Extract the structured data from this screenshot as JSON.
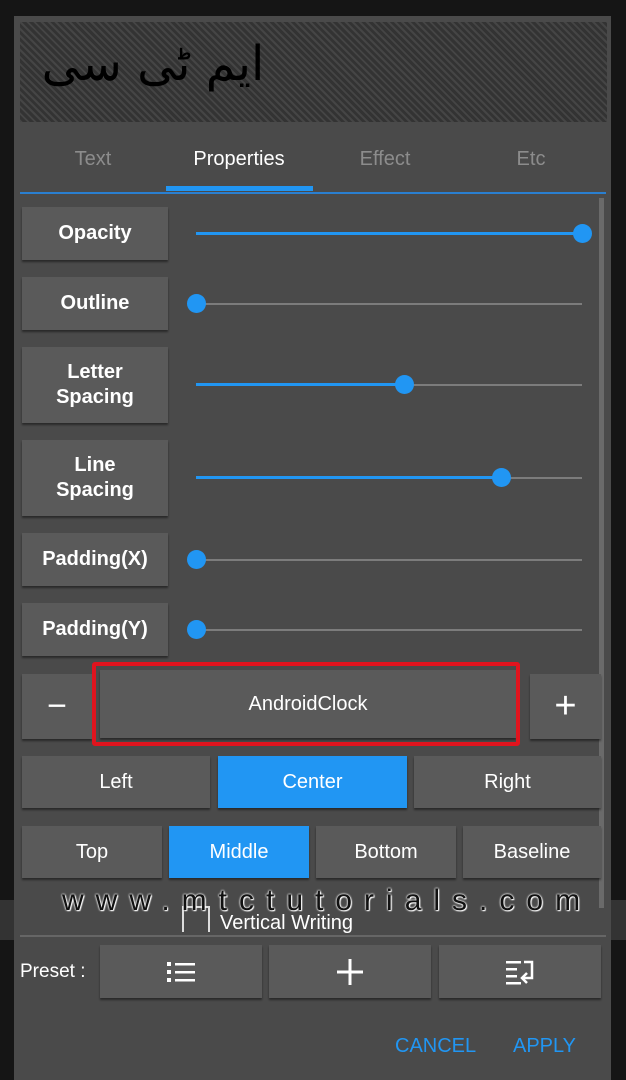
{
  "preview": {
    "text": "ایم ٹی سی"
  },
  "tabs": [
    {
      "label": "Text",
      "active": false
    },
    {
      "label": "Properties",
      "active": true
    },
    {
      "label": "Effect",
      "active": false
    },
    {
      "label": "Etc",
      "active": false
    }
  ],
  "properties": [
    {
      "label": "Opacity",
      "value": 1.0
    },
    {
      "label": "Outline",
      "value": 0.0
    },
    {
      "label": "Letter\nSpacing",
      "value": 0.54
    },
    {
      "label": "Line\nSpacing",
      "value": 0.79
    },
    {
      "label": "Padding(X)",
      "value": 0.0
    },
    {
      "label": "Padding(Y)",
      "value": 0.0
    }
  ],
  "font": {
    "decrease": "−",
    "name": "AndroidClock",
    "increase": "+"
  },
  "horizontal_align": {
    "options": [
      "Left",
      "Center",
      "Right"
    ],
    "selected": "Center"
  },
  "vertical_align": {
    "options": [
      "Top",
      "Middle",
      "Bottom",
      "Baseline"
    ],
    "selected": "Middle"
  },
  "watermark": "www.mtctutorials.com",
  "vertical_writing": {
    "label": "Vertical Writing",
    "checked": false
  },
  "preset": {
    "label": "Preset :",
    "buttons": [
      "list-icon",
      "plus-icon",
      "import-icon"
    ]
  },
  "actions": {
    "cancel": "CANCEL",
    "apply": "APPLY"
  },
  "colors": {
    "accent": "#2196f3",
    "highlight": "#e0141e",
    "button": "#5a5a5a",
    "dialog": "#4a4a4a"
  }
}
